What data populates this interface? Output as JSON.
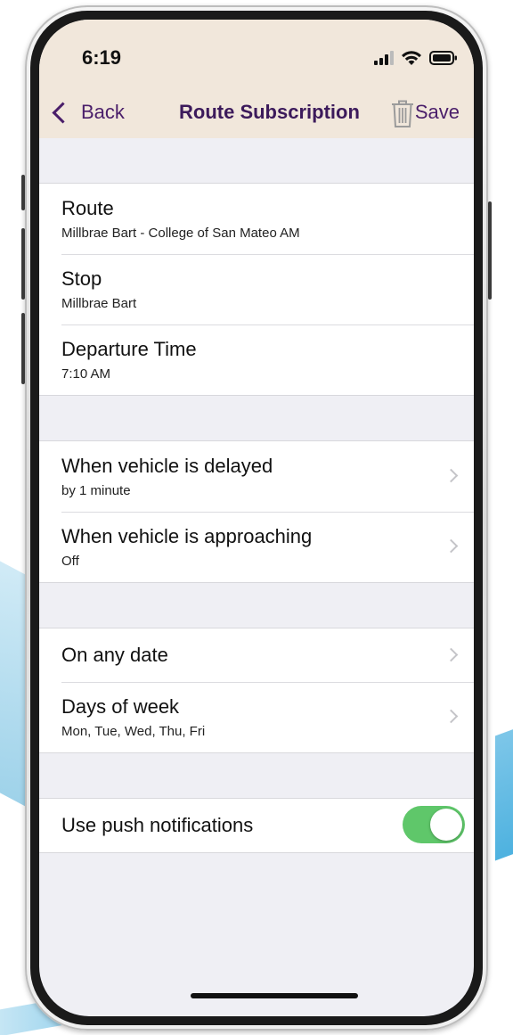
{
  "status_bar": {
    "time": "6:19"
  },
  "navbar": {
    "back_label": "Back",
    "title": "Route Subscription",
    "save_label": "Save"
  },
  "trip": {
    "route": {
      "title": "Route",
      "value": "Millbrae Bart - College of San Mateo AM"
    },
    "stop": {
      "title": "Stop",
      "value": "Millbrae Bart"
    },
    "departure": {
      "title": "Departure Time",
      "value": "7:10 AM"
    }
  },
  "alerts": {
    "delayed": {
      "title": "When vehicle is delayed",
      "value": "by 1 minute"
    },
    "approaching": {
      "title": "When vehicle is approaching",
      "value": "Off"
    }
  },
  "schedule": {
    "any_date": {
      "title": "On any date"
    },
    "days": {
      "title": "Days of week",
      "value": "Mon, Tue, Wed, Thu, Fri"
    }
  },
  "push": {
    "title": "Use push notifications",
    "enabled": true
  },
  "colors": {
    "accent": "#4a1e6a",
    "header_bg": "#f1e7db",
    "toggle_on": "#5fc76a",
    "background": "#efeff4"
  },
  "icons": {
    "back": "chevron-left-icon",
    "trash": "trash-icon",
    "disclosure": "chevron-right-icon",
    "signal": "cellular-signal-icon",
    "wifi": "wifi-icon",
    "battery": "battery-icon"
  }
}
